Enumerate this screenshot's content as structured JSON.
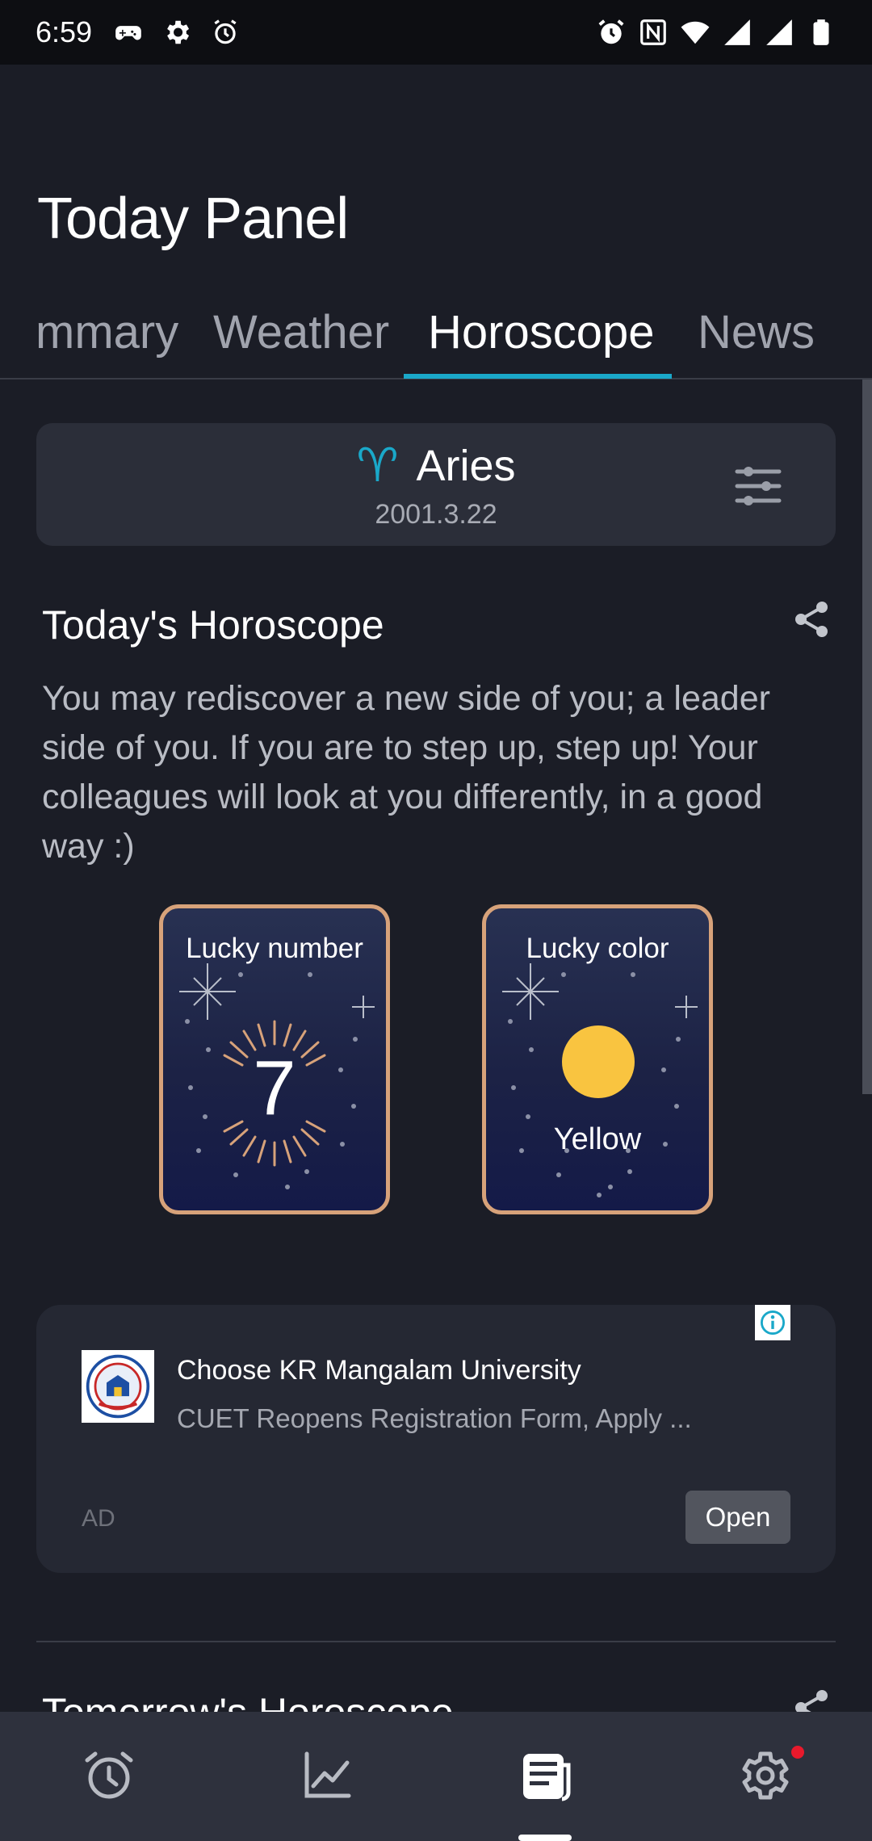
{
  "status_bar": {
    "time": "6:59",
    "left_icons": [
      "game-controller-icon",
      "gear-icon",
      "alarm-outline-icon"
    ],
    "right_icons": [
      "alarm-icon",
      "nfc-icon",
      "wifi-icon",
      "signal-icon",
      "signal-icon",
      "battery-icon"
    ]
  },
  "header": {
    "title": "Today Panel"
  },
  "tabs": [
    {
      "label": "mmary",
      "active": false
    },
    {
      "label": "Weather",
      "active": false
    },
    {
      "label": "Horoscope",
      "active": true
    },
    {
      "label": "News",
      "active": false
    }
  ],
  "sign": {
    "glyph": "♈",
    "name": "Aries",
    "date": "2001.3.22"
  },
  "horoscope": {
    "title": "Today's Horoscope",
    "text": "You may rediscover a new side of you; a leader side of you. If you are to step up, step up! Your colleagues will look at you differently, in a good way :)"
  },
  "lucky_number": {
    "label": "Lucky number",
    "value": "7"
  },
  "lucky_color": {
    "label": "Lucky color",
    "value": "Yellow",
    "swatch": "#f9c440"
  },
  "ad": {
    "title": "Choose KR Mangalam University",
    "description": "CUET Reopens Registration Form, Apply ...",
    "label": "AD",
    "button": "Open"
  },
  "next_section": {
    "title": "Tomorrow's Horoscope"
  },
  "bottom_nav": [
    {
      "icon": "alarm-clock-icon",
      "active": false
    },
    {
      "icon": "chart-line-icon",
      "active": false
    },
    {
      "icon": "article-icon",
      "active": true
    },
    {
      "icon": "settings-icon",
      "active": false,
      "badge": true
    }
  ],
  "colors": {
    "accent": "#1aa8c9",
    "background": "#1b1d26",
    "card": "#2b2e39",
    "card_border": "#d7a27a",
    "badge": "#e8192c"
  }
}
